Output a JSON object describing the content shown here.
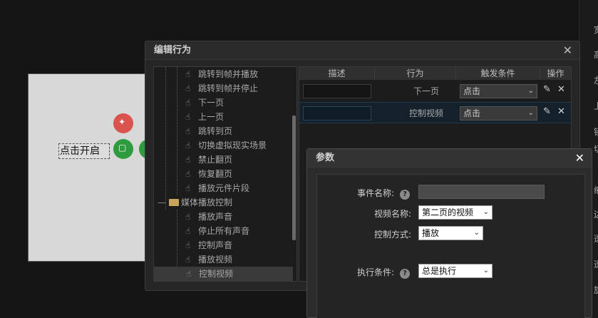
{
  "right_panel": {
    "items": [
      "宽",
      "高",
      "左",
      "上",
      "锁",
      "切",
      "缩",
      "边",
      "透",
      "透",
      "旋"
    ]
  },
  "canvas": {
    "start_text": "点击开启"
  },
  "behavior_dialog": {
    "title": "编辑行为",
    "close_label": "✕",
    "tree": {
      "items": [
        "跳转到帧并播放",
        "跳转到帧并停止",
        "下一页",
        "上一页",
        "跳转到页",
        "切换虚拟现实场景",
        "禁止翻页",
        "恢复翻页",
        "播放元件片段"
      ],
      "group": "媒体播放控制",
      "group_items": [
        "播放声音",
        "停止所有声音",
        "控制声音",
        "播放视频",
        "控制视频"
      ]
    },
    "table": {
      "headers": [
        "描述",
        "行为",
        "触发条件",
        "操作"
      ],
      "rows": [
        {
          "action": "下一页",
          "trigger": "点击"
        },
        {
          "action": "控制视频",
          "trigger": "点击"
        }
      ]
    }
  },
  "param_dialog": {
    "title": "参数",
    "close_label": "✕",
    "event_name_label": "事件名称:",
    "event_name_value": "",
    "video_name_label": "视频名称:",
    "video_name_value": "第二页的视频",
    "control_label": "控制方式:",
    "control_value": "播放",
    "exec_label": "执行条件:",
    "exec_value": "总是执行"
  }
}
